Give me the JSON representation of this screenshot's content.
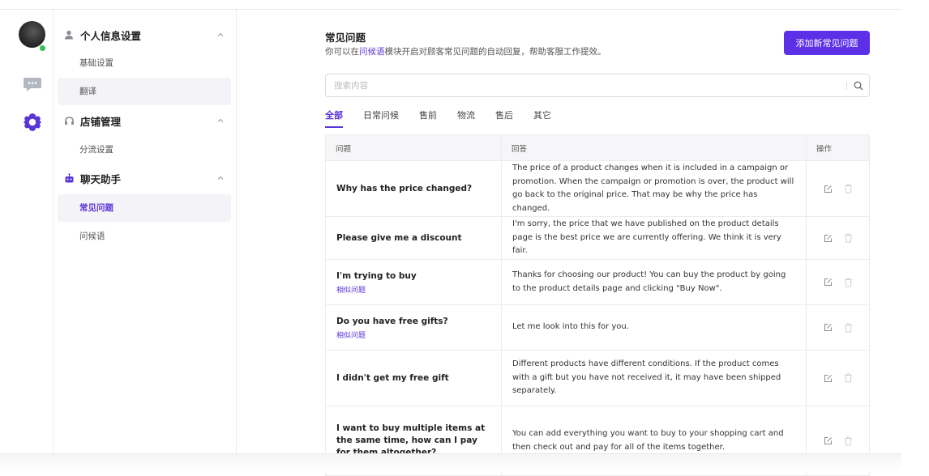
{
  "sidebar": {
    "groups": [
      {
        "title": "个人信息设置",
        "icon": "user-icon",
        "items": [
          "基础设置",
          "翻译"
        ]
      },
      {
        "title": "店铺管理",
        "icon": "headset-icon",
        "items": [
          "分流设置"
        ]
      },
      {
        "title": "聊天助手",
        "icon": "robot-icon",
        "items": [
          "常见问题",
          "问候语"
        ]
      }
    ],
    "active_item": "常见问题"
  },
  "rail": {
    "icons": [
      "avatar",
      "chat-bubble-icon",
      "gear-icon"
    ]
  },
  "main": {
    "title": "常见问题",
    "desc_prefix": "你可以在",
    "desc_link": "问候语",
    "desc_suffix": "模块开启对顾客常见问题的自动回复，帮助客服工作提效。",
    "add_button": "添加新常见问题",
    "search_placeholder": "搜索内容",
    "tabs": [
      "全部",
      "日常问候",
      "售前",
      "物流",
      "售后",
      "其它"
    ],
    "active_tab": "全部",
    "table": {
      "headers": [
        "问题",
        "回答",
        "操作"
      ],
      "rows": [
        {
          "q": "Why has the price changed?",
          "similar": "",
          "a": "The price of a product changes when it is included in a campaign or promotion. When the campaign or promotion is over, the product will go back to the original price. That may be why the price has changed."
        },
        {
          "q": "Please give me a discount",
          "similar": "",
          "a": "I'm sorry, the price that we have published on the product details page is the best price we are currently offering. We think it is very fair."
        },
        {
          "q": "I'm trying to buy",
          "similar": "相似问题",
          "a": "Thanks for choosing our product! You can buy the product by going to the product details page and clicking \"Buy Now\"."
        },
        {
          "q": "Do you have free gifts?",
          "similar": "相似问题",
          "a": "Let me look into this for you."
        },
        {
          "q": "I didn't get my free gift",
          "similar": "",
          "a": "Different products have different conditions. If the product comes with a gift but you have not received it, it may have been shipped separately."
        },
        {
          "q": "I want to buy multiple items at the same time, how can I pay for them altogether?",
          "similar": "",
          "a": "You can add everything you want to buy to your shopping cart and then check out and pay for all of the items together."
        }
      ]
    }
  },
  "colors": {
    "accent": "#5a35d8",
    "button": "#5b30e6",
    "online": "#32c05a"
  }
}
